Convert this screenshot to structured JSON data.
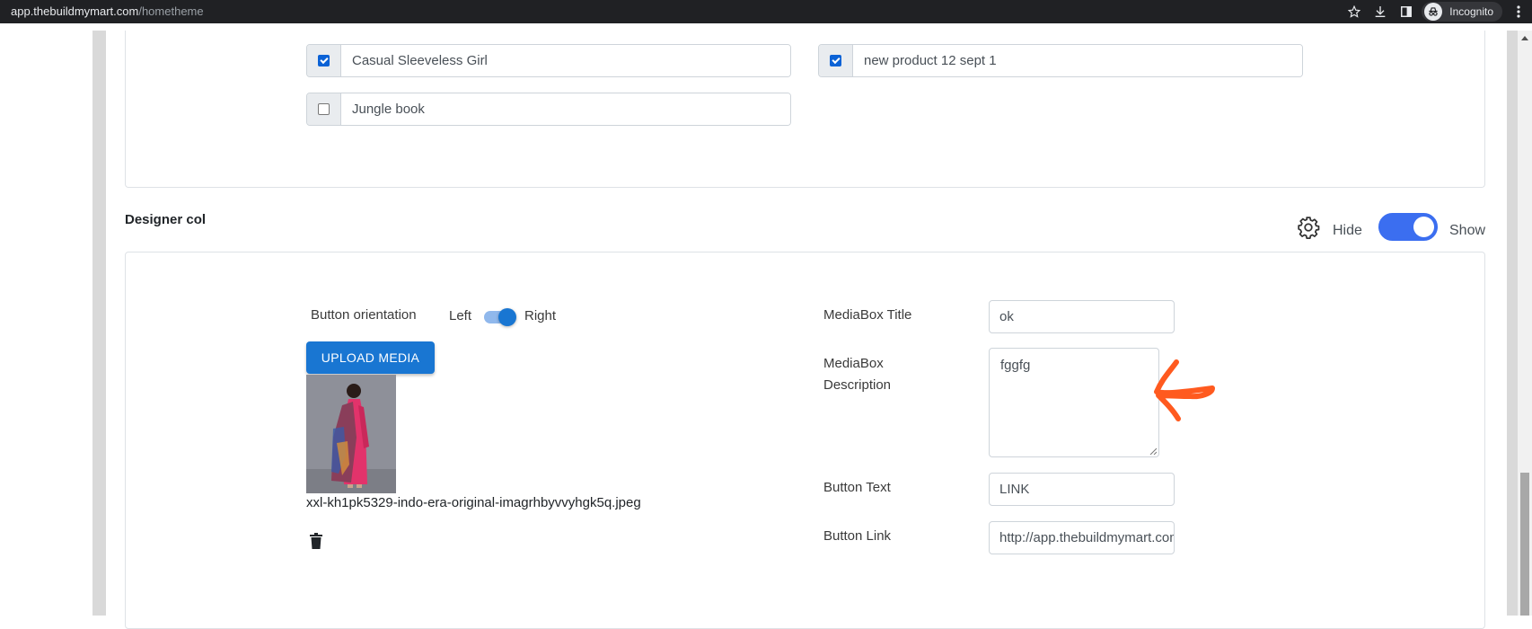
{
  "browser": {
    "url_host": "app.thebuildmymart.com",
    "url_path": "/hometheme",
    "profile_label": "Incognito"
  },
  "products": {
    "items": [
      {
        "label": "Casual Sleeveless  Girl",
        "checked": true
      },
      {
        "label": "new product 12 sept 1",
        "checked": true
      },
      {
        "label": "Jungle book",
        "checked": false
      }
    ]
  },
  "designer": {
    "section_title": "Designer col",
    "hide_label": "Hide",
    "show_label": "Show",
    "visibility_on": true,
    "button_orientation_label": "Button orientation",
    "orientation_left": "Left",
    "orientation_right": "Right",
    "orientation_value": "Right",
    "upload_button": "UPLOAD MEDIA",
    "file_name": "xxl-kh1pk5329-indo-era-original-imagrhbyvvyhgk5q.jpeg",
    "mediabox_title_label": "MediaBox Title",
    "mediabox_title_value": "ok",
    "mediabox_desc_label_line1": "MediaBox",
    "mediabox_desc_label_line2": "Description",
    "mediabox_desc_value": "fggfg",
    "button_text_label": "Button Text",
    "button_text_value": "LINK",
    "button_link_label": "Button Link",
    "button_link_value": "http://app.thebuildmymart.com"
  },
  "colors": {
    "primary": "#1976d2",
    "toggle_on": "#3b6ef0",
    "annotation": "#ff5a1f"
  }
}
